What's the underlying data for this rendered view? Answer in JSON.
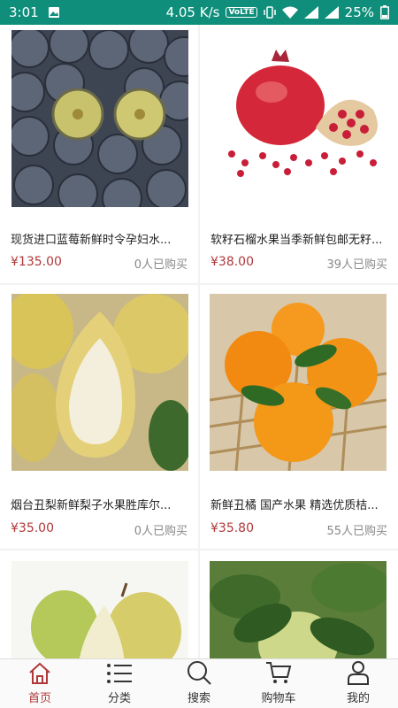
{
  "status": {
    "time": "3:01",
    "speed": "4.05 K/s",
    "volte": "VoLTE",
    "battery": "25%"
  },
  "products": [
    {
      "title": "现货进口蓝莓新鲜时令孕妇水...",
      "price": "¥135.00",
      "sold": "0人已购买",
      "image_icon": "blueberry-image"
    },
    {
      "title": "软籽石榴水果当季新鲜包邮无籽...",
      "price": "¥38.00",
      "sold": "39人已购买",
      "image_icon": "pomegranate-image"
    },
    {
      "title": "烟台丑梨新鲜梨子水果胜库尔...",
      "price": "¥35.00",
      "sold": "0人已购买",
      "image_icon": "ugly-pear-image"
    },
    {
      "title": "新鲜丑橘 国产水果 精选优质桔...",
      "price": "¥35.80",
      "sold": "55人已购买",
      "image_icon": "dekopon-image"
    },
    {
      "title": "",
      "price": "",
      "sold": "",
      "image_icon": "pear-image"
    },
    {
      "title": "",
      "price": "",
      "sold": "",
      "image_icon": "pomelo-tree-image"
    }
  ],
  "tabs": [
    {
      "label": "首页",
      "icon": "home-icon",
      "active": true
    },
    {
      "label": "分类",
      "icon": "category-list-icon"
    },
    {
      "label": "搜索",
      "icon": "search-icon"
    },
    {
      "label": "购物车",
      "icon": "cart-icon"
    },
    {
      "label": "我的",
      "icon": "profile-icon"
    }
  ],
  "colors": {
    "status_bar": "#0f8f7b",
    "accent": "#b0383a"
  }
}
